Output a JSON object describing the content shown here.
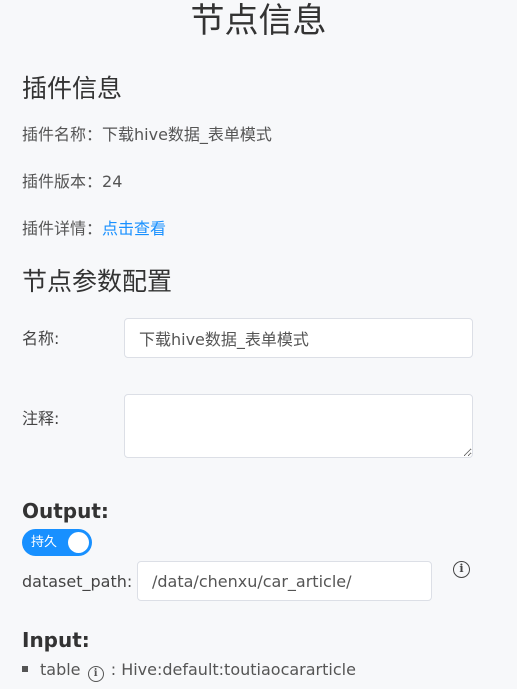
{
  "page": {
    "title": "节点信息"
  },
  "plugin_info": {
    "title": "插件信息",
    "name_label": "插件名称：",
    "name_value": "下载hive数据_表单模式",
    "version_label": "插件版本：",
    "version_value": "24",
    "detail_label": "插件详情：",
    "detail_link": "点击查看"
  },
  "node_config": {
    "title": "节点参数配置",
    "name_label": "名称:",
    "name_value": "下载hive数据_表单模式",
    "note_label": "注释:",
    "note_value": ""
  },
  "output": {
    "title": "Output:",
    "persist_toggle_label": "持久",
    "persist_toggle_on": true,
    "dataset_path_label": "dataset_path:",
    "dataset_path_value": "/data/chenxu/car_article/",
    "info_icon": "info-icon"
  },
  "input": {
    "title": "Input:",
    "items": [
      {
        "name": "table",
        "separator": " : ",
        "value": "Hive:default:toutiaocararticle"
      }
    ]
  },
  "colors": {
    "accent": "#1890ff",
    "background": "#f7f8fa"
  }
}
